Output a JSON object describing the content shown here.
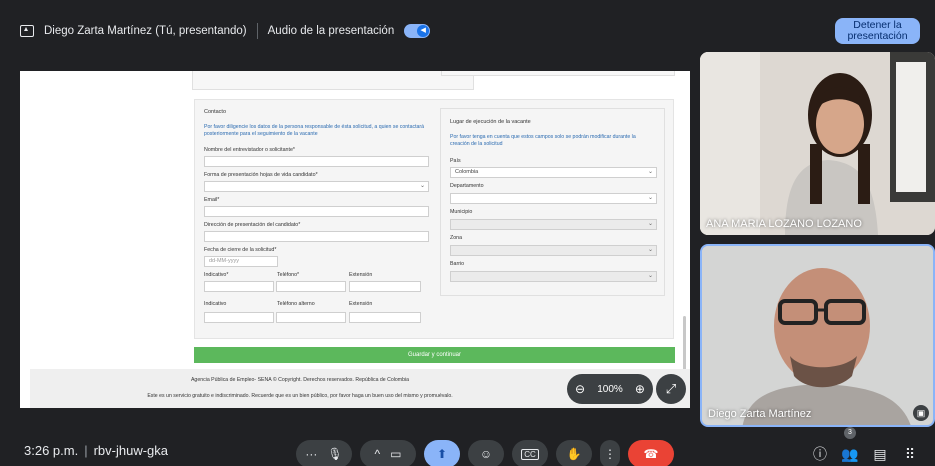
{
  "topbar": {
    "presenter": "Diego Zarta Martínez (Tú, presentando)",
    "audio_label": "Audio de la presentación",
    "stop_button": "Detener la presentación"
  },
  "form": {
    "contact_title": "Contacto",
    "contact_help": "Por favor diligencie los datos de la persona responsable de ésta solicitud, a quien se contactará posteriormente para el seguimiento de la vacante",
    "interviewer_label": "Nombre del entrevistador o solicitante*",
    "cv_form_label": "Forma de presentación hojas de vida candidato*",
    "email_label": "Email*",
    "address_label": "Dirección de presentación del candidato*",
    "close_date_label": "Fecha de cierre de la solicitud*",
    "close_date_placeholder": "dd-MM-yyyy",
    "indicativo_req_label": "Indicativo*",
    "telefono_req_label": "Teléfono*",
    "extension_label_1": "Extensión",
    "indicativo_label": "Indicativo",
    "telefono_alt_label": "Teléfono alterno",
    "extension_label_2": "Extensión",
    "location_title": "Lugar de ejecución de la vacante",
    "location_help": "Por favor tenga en cuenta que estos campos solo se podrán modificar durante la creación de la solicitud",
    "pais_label": "País",
    "pais_value": "Colombia",
    "departamento_label": "Departamento",
    "municipio_label": "Municipio",
    "zona_label": "Zona",
    "barrio_label": "Barrio",
    "save_button": "Guardar y continuar",
    "footer_line1": "Agencia Pública de Empleo- SENA © Copyright. Derechos reservados. República de Colombia",
    "footer_line2": "Este es un servicio gratuito e indiscriminado. Recuerde que es un bien público, por favor haga un buen uso del mismo y promuévalo."
  },
  "zoom": {
    "level": "100%"
  },
  "participants": [
    {
      "name": "ANA MARIA LOZANO LOZANO"
    },
    {
      "name": "Diego Zarta Martínez"
    }
  ],
  "bottombar": {
    "time": "3:26 p.m.",
    "meeting_code": "rbv-jhuw-gka",
    "people_count": "3"
  },
  "colors": {
    "accent": "#8ab4f8",
    "end_call": "#ea4335",
    "save_button": "#5cb85c"
  }
}
